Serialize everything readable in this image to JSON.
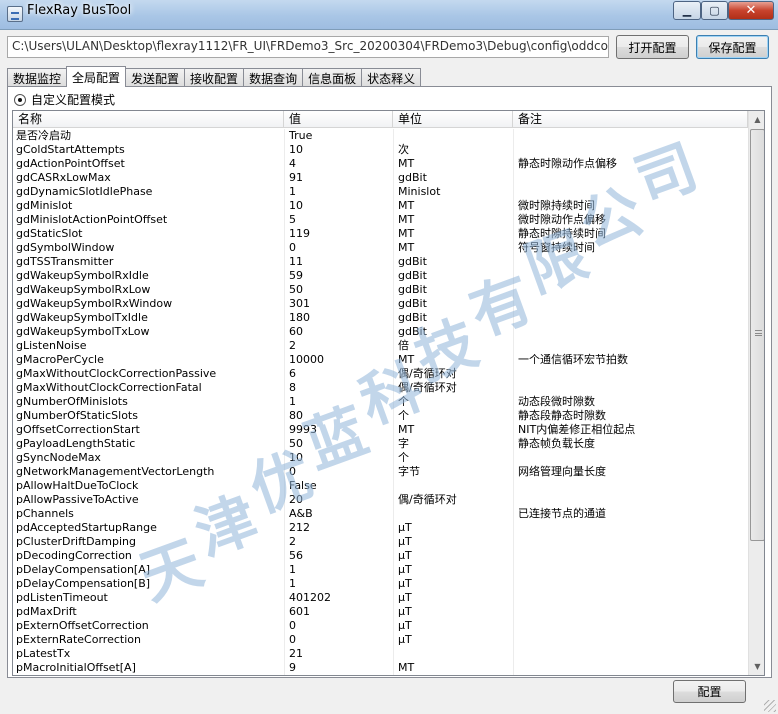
{
  "window": {
    "title": "FlexRay BusTool",
    "min_icon": "minimize-icon",
    "max_icon": "maximize-icon",
    "close_icon": "close-icon",
    "min_glyph": "▁",
    "max_glyph": "▢",
    "close_glyph": "✕"
  },
  "toolbar": {
    "path": "C:\\Users\\ULAN\\Desktop\\flexray1112\\FR_UI\\FRDemo3_Src_20200304\\FRDemo3\\Debug\\config\\oddcont28_re",
    "open_label": "打开配置",
    "save_label": "保存配置"
  },
  "tabs": [
    "数据监控",
    "全局配置",
    "发送配置",
    "接收配置",
    "数据查询",
    "信息面板",
    "状态释义"
  ],
  "active_tab": 1,
  "radio": {
    "label": "自定义配置模式",
    "checked": true
  },
  "table": {
    "headers": [
      "名称",
      "值",
      "单位",
      "备注"
    ],
    "rows": [
      [
        "是否冷启动",
        "True",
        "",
        ""
      ],
      [
        "gColdStartAttempts",
        "10",
        "次",
        ""
      ],
      [
        "gdActionPointOffset",
        "4",
        "MT",
        "静态时隙动作点偏移"
      ],
      [
        "gdCASRxLowMax",
        "91",
        "gdBit",
        ""
      ],
      [
        "gdDynamicSlotIdlePhase",
        "1",
        "Minislot",
        ""
      ],
      [
        "gdMinislot",
        "10",
        "MT",
        "微时隙持续时间"
      ],
      [
        "gdMinislotActionPointOffset",
        "5",
        "MT",
        "微时隙动作点偏移"
      ],
      [
        "gdStaticSlot",
        "119",
        "MT",
        "静态时隙持续时间"
      ],
      [
        "gdSymbolWindow",
        "0",
        "MT",
        "符号窗持续时间"
      ],
      [
        "gdTSSTransmitter",
        "11",
        "gdBit",
        ""
      ],
      [
        "gdWakeupSymbolRxIdle",
        "59",
        "gdBit",
        ""
      ],
      [
        "gdWakeupSymbolRxLow",
        "50",
        "gdBit",
        ""
      ],
      [
        "gdWakeupSymbolRxWindow",
        "301",
        "gdBit",
        ""
      ],
      [
        "gdWakeupSymbolTxIdle",
        "180",
        "gdBit",
        ""
      ],
      [
        "gdWakeupSymbolTxLow",
        "60",
        "gdBit",
        ""
      ],
      [
        "gListenNoise",
        "2",
        "倍",
        ""
      ],
      [
        "gMacroPerCycle",
        "10000",
        "MT",
        "一个通信循环宏节拍数"
      ],
      [
        "gMaxWithoutClockCorrectionPassive",
        "6",
        "偶/奇循环对",
        ""
      ],
      [
        "gMaxWithoutClockCorrectionFatal",
        "8",
        "偶/奇循环对",
        ""
      ],
      [
        "gNumberOfMinislots",
        "1",
        "个",
        "动态段微时隙数"
      ],
      [
        "gNumberOfStaticSlots",
        "80",
        "个",
        "静态段静态时隙数"
      ],
      [
        "gOffsetCorrectionStart",
        "9993",
        "MT",
        "NIT内偏差修正相位起点"
      ],
      [
        "gPayloadLengthStatic",
        "50",
        "字",
        "静态帧负载长度"
      ],
      [
        "gSyncNodeMax",
        "10",
        "个",
        ""
      ],
      [
        "gNetworkManagementVectorLength",
        "0",
        "字节",
        "网络管理向量长度"
      ],
      [
        "pAllowHaltDueToClock",
        "False",
        "",
        ""
      ],
      [
        "pAllowPassiveToActive",
        "20",
        "偶/奇循环对",
        ""
      ],
      [
        "pChannels",
        "A&B",
        "",
        "已连接节点的通道"
      ],
      [
        "pdAcceptedStartupRange",
        "212",
        "μT",
        ""
      ],
      [
        "pClusterDriftDamping",
        "2",
        "μT",
        ""
      ],
      [
        "pDecodingCorrection",
        "56",
        "μT",
        ""
      ],
      [
        "pDelayCompensation[A]",
        "1",
        "μT",
        ""
      ],
      [
        "pDelayCompensation[B]",
        "1",
        "μT",
        ""
      ],
      [
        "pdListenTimeout",
        "401202",
        "μT",
        ""
      ],
      [
        "pdMaxDrift",
        "601",
        "μT",
        ""
      ],
      [
        "pExternOffsetCorrection",
        "0",
        "μT",
        ""
      ],
      [
        "pExternRateCorrection",
        "0",
        "μT",
        ""
      ],
      [
        "pLatestTx",
        "21",
        "",
        ""
      ],
      [
        "pMacroInitialOffset[A]",
        "9",
        "MT",
        ""
      ]
    ]
  },
  "watermark": "天津优蓝科技有限公司",
  "footer": {
    "config_label": "配置"
  }
}
